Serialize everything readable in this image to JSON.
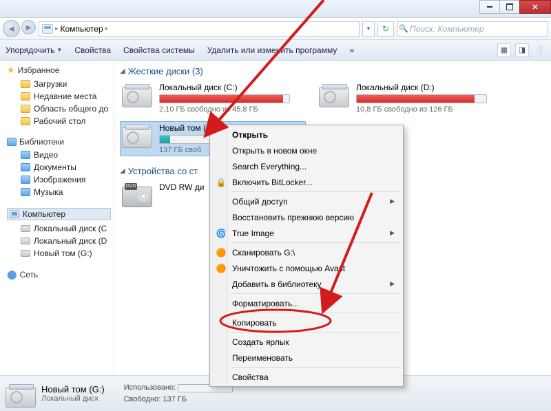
{
  "titlebar": {
    "min": "min",
    "max": "max",
    "close": "close"
  },
  "addressbar": {
    "crumb1": "Компьютер",
    "search_placeholder": "Поиск: Компьютер"
  },
  "toolbar": {
    "organize": "Упорядочить",
    "props": "Свойства",
    "sysprops": "Свойства системы",
    "uninstall": "Удалить или изменить программу",
    "more": "»"
  },
  "sidebar": {
    "favorites": "Избранное",
    "fav_items": [
      "Загрузки",
      "Недавние места",
      "Область общего до",
      "Рабочий стол"
    ],
    "libraries": "Библиотеки",
    "lib_items": [
      "Видео",
      "Документы",
      "Изображения",
      "Музыка"
    ],
    "computer": "Компьютер",
    "comp_items": [
      "Локальный диск (C",
      "Локальный диск (D",
      "Новый том (G:)"
    ],
    "network": "Сеть"
  },
  "content": {
    "section_drives": "Жесткие диски (3)",
    "section_removable": "Устройства со ст",
    "drives": [
      {
        "name": "Локальный диск (C:)",
        "sub": "2,10 ГБ свободно из 45,8 ГБ",
        "pct": 95,
        "color": "red"
      },
      {
        "name": "Локальный диск (D:)",
        "sub": "10,8 ГБ свободно из 126 ГБ",
        "pct": 91,
        "color": "red"
      },
      {
        "name": "Новый том (G:)",
        "sub": "137 ГБ своб",
        "pct": 8,
        "color": "teal"
      }
    ],
    "dvd_name": "DVD RW ди"
  },
  "contextmenu": {
    "items": [
      {
        "label": "Открыть",
        "bold": true
      },
      {
        "label": "Открыть в новом окне"
      },
      {
        "label": "Search Everything..."
      },
      {
        "label": "Включить BitLocker...",
        "icon": "🔒"
      },
      {
        "sep": true
      },
      {
        "label": "Общий доступ",
        "sub": true
      },
      {
        "label": "Восстановить прежнюю версию"
      },
      {
        "label": "True Image",
        "icon": "🌀",
        "sub": true
      },
      {
        "sep": true
      },
      {
        "label": "Сканировать G:\\",
        "icon": "🟠"
      },
      {
        "label": "Уничтожить с помощью Avast",
        "icon": "🟠"
      },
      {
        "label": "Добавить в библиотеку",
        "sub": true
      },
      {
        "sep": true
      },
      {
        "label": "Форматировать..."
      },
      {
        "sep": true
      },
      {
        "label": "Копировать"
      },
      {
        "sep": true
      },
      {
        "label": "Создать ярлык"
      },
      {
        "label": "Переименовать"
      },
      {
        "sep": true
      },
      {
        "label": "Свойства"
      }
    ]
  },
  "footer": {
    "name": "Новый том (G:)",
    "sub": "Локальный диск",
    "used_label": "Использовано:",
    "free_label": "Свободно: 137 ГБ"
  }
}
